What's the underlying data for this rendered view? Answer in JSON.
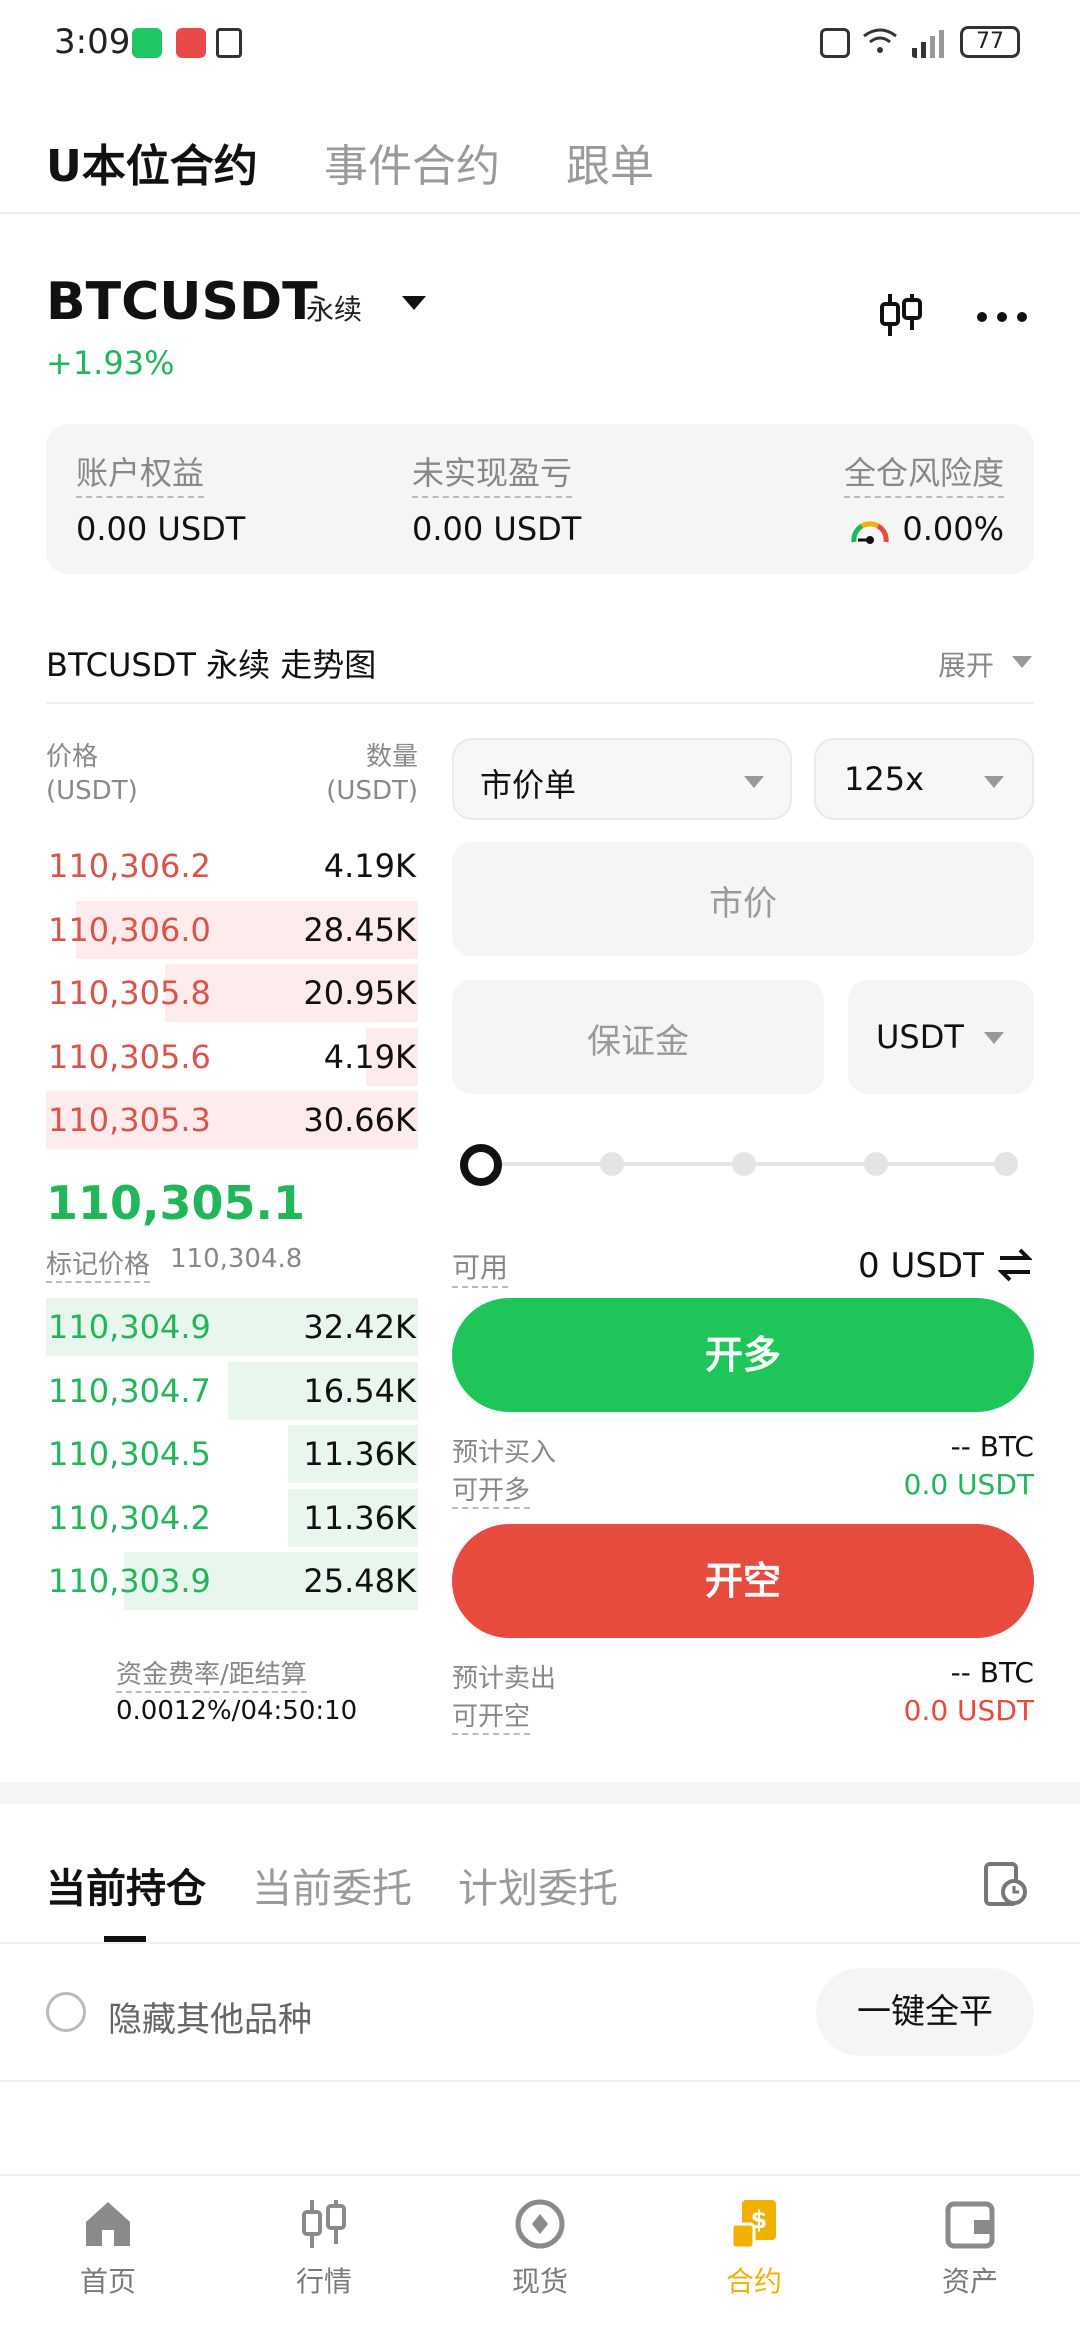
{
  "status_bar": {
    "time": "3:09",
    "battery": "77"
  },
  "top_tabs": [
    {
      "label": "U本位合约",
      "active": true
    },
    {
      "label": "事件合约",
      "active": false
    },
    {
      "label": "跟单",
      "active": false
    }
  ],
  "instrument": {
    "symbol": "BTCUSDT",
    "type": "永续",
    "change": "+1.93%",
    "up_color": "#22b55a",
    "down_color": "#d9544a"
  },
  "account": {
    "equity_label": "账户权益",
    "equity_value": "0.00 USDT",
    "upnl_label": "未实现盈亏",
    "upnl_value": "0.00 USDT",
    "risk_label": "全仓风险度",
    "risk_value": "0.00%"
  },
  "chart_section": {
    "title": "BTCUSDT 永续 走势图",
    "expand": "展开"
  },
  "orderbook": {
    "price_header": "价格",
    "price_unit": "(USDT)",
    "qty_header": "数量",
    "qty_unit": "(USDT)",
    "asks": [
      {
        "price": "110,306.2",
        "qty": "4.19K",
        "depth": 0
      },
      {
        "price": "110,306.0",
        "qty": "28.45K",
        "depth": 0.92
      },
      {
        "price": "110,305.8",
        "qty": "20.95K",
        "depth": 0.68
      },
      {
        "price": "110,305.6",
        "qty": "4.19K",
        "depth": 0.14
      },
      {
        "price": "110,305.3",
        "qty": "30.66K",
        "depth": 1.0
      }
    ],
    "last_price": "110,305.1",
    "mark_label": "标记价格",
    "mark_price": "110,304.8",
    "bids": [
      {
        "price": "110,304.9",
        "qty": "32.42K",
        "depth": 1.0
      },
      {
        "price": "110,304.7",
        "qty": "16.54K",
        "depth": 0.51
      },
      {
        "price": "110,304.5",
        "qty": "11.36K",
        "depth": 0.35
      },
      {
        "price": "110,304.2",
        "qty": "11.36K",
        "depth": 0.35
      },
      {
        "price": "110,303.9",
        "qty": "25.48K",
        "depth": 0.79
      }
    ],
    "funding_label": "资金费率/距结算",
    "funding_value": "0.0012%/04:50:10"
  },
  "order_form": {
    "order_type": "市价单",
    "leverage": "125x",
    "price_placeholder": "市价",
    "margin_placeholder": "保证金",
    "margin_unit": "USDT",
    "slider_value": 0,
    "available_label": "可用",
    "available_value": "0 USDT",
    "long_button": "开多",
    "est_buy_label": "预计买入",
    "est_buy_value": "-- BTC",
    "can_long_label": "可开多",
    "can_long_value": "0.0 USDT",
    "short_button": "开空",
    "est_sell_label": "预计卖出",
    "est_sell_value": "-- BTC",
    "can_short_label": "可开空",
    "can_short_value": "0.0 USDT"
  },
  "positions": {
    "tabs": [
      {
        "label": "当前持仓",
        "active": true
      },
      {
        "label": "当前委托",
        "active": false
      },
      {
        "label": "计划委托",
        "active": false
      }
    ],
    "hide_others": "隐藏其他品种",
    "close_all": "一键全平"
  },
  "bottom_nav": [
    {
      "label": "首页",
      "icon": "home-icon",
      "active": false
    },
    {
      "label": "行情",
      "icon": "market-icon",
      "active": false
    },
    {
      "label": "现货",
      "icon": "spot-icon",
      "active": false
    },
    {
      "label": "合约",
      "icon": "futures-icon",
      "active": true
    },
    {
      "label": "资产",
      "icon": "wallet-icon",
      "active": false
    }
  ],
  "accent_color": "#f2b000"
}
